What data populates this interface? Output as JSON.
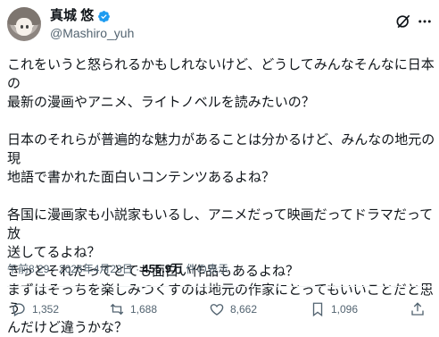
{
  "author": {
    "display_name": "真城 悠",
    "handle": "@Mashiro_yuh"
  },
  "post": {
    "line1": "これをいうと怒られるかもしれないけど、どうしてみんなそんなに日本の",
    "line2": "最新の漫画やアニメ、ライトノベルを読みたいの？",
    "line3": "日本のそれらが普遍的な魅力があることは分かるけど、みんなの地元の現",
    "line4": "地語で書かれた面白いコンテンツあるよね？",
    "line5": "各国に漫画家も小説家もいるし、アニメだって映画だってドラマだって放",
    "line6": "送してるよね？",
    "line7": "きっとそれだってとても面白い作品もあるよね？",
    "line8": "まずはそっちを楽しみつくすのは地元の作家にとってもいいことだと思う",
    "line9": "んだけど違うかな？"
  },
  "meta": {
    "time": "午前8:29",
    "sep1": " · ",
    "date": "2026年4月23日",
    "sep2": " · ",
    "views": "455.9万",
    "views_suffix": " 件の表示"
  },
  "actions": {
    "replies": "1,352",
    "reposts": "1,688",
    "likes": "8,662",
    "bookmarks": "1,096"
  },
  "icons": {
    "verified": "verified-badge-icon",
    "grok": "grok-icon",
    "more": "more-icon",
    "reply": "reply-icon",
    "repost": "repost-icon",
    "like": "heart-icon",
    "bookmark": "bookmark-icon",
    "share": "share-icon"
  },
  "colors": {
    "verified": "#1d9bf0",
    "text": "#0f1419",
    "secondary": "#536471"
  }
}
